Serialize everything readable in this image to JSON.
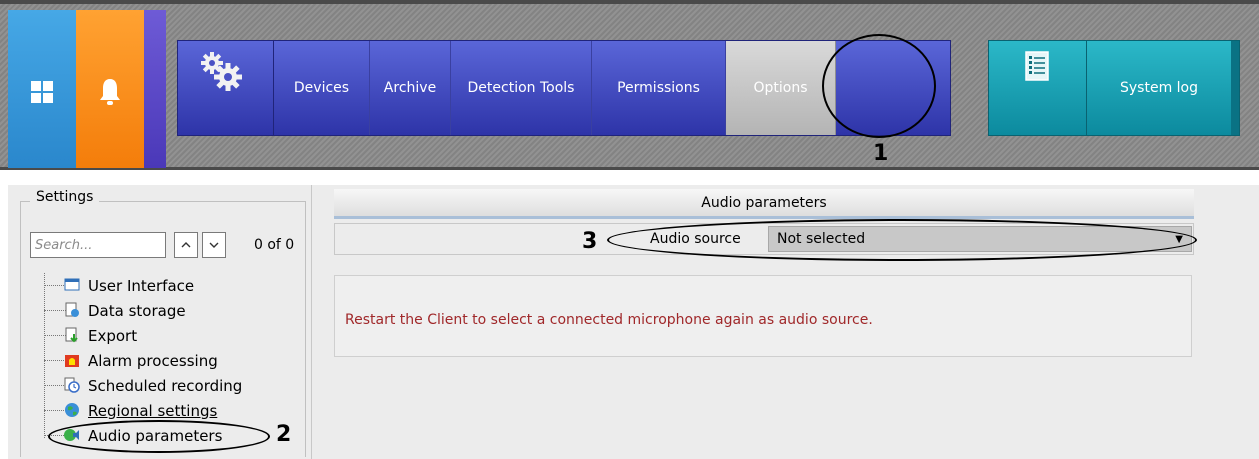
{
  "topbar": {
    "nav_items": [
      "Devices",
      "Archive",
      "Detection Tools",
      "Permissions",
      "Options"
    ],
    "active_item": "Options",
    "system_log_label": "System log",
    "colors": {
      "tile_windows": "#3a9be0",
      "tile_bell": "#f58a18",
      "tile_purple": "#5c4ac8",
      "nav_blue": "#3c43b8",
      "log_teal": "#1aa3b5",
      "active_grey": "#c4c4c4"
    }
  },
  "callouts": {
    "one": "1",
    "two": "2",
    "three": "3"
  },
  "settings": {
    "title": "Settings",
    "search": {
      "placeholder": "Search...",
      "value": ""
    },
    "count": "0 of 0",
    "tree": [
      {
        "label": "User Interface",
        "icon": "window-icon"
      },
      {
        "label": "Data storage",
        "icon": "storage-icon"
      },
      {
        "label": "Export",
        "icon": "export-icon"
      },
      {
        "label": "Alarm processing",
        "icon": "alarm-icon"
      },
      {
        "label": "Scheduled recording",
        "icon": "clock-icon"
      },
      {
        "label": "Regional settings",
        "icon": "globe-icon"
      },
      {
        "label": "Audio parameters",
        "icon": "audio-icon"
      }
    ]
  },
  "audio": {
    "header": "Audio parameters",
    "source_label": "Audio source",
    "source_value": "Not selected",
    "message": "Restart the Client to select a connected microphone again as audio source.",
    "message_color": "#a0282a"
  }
}
